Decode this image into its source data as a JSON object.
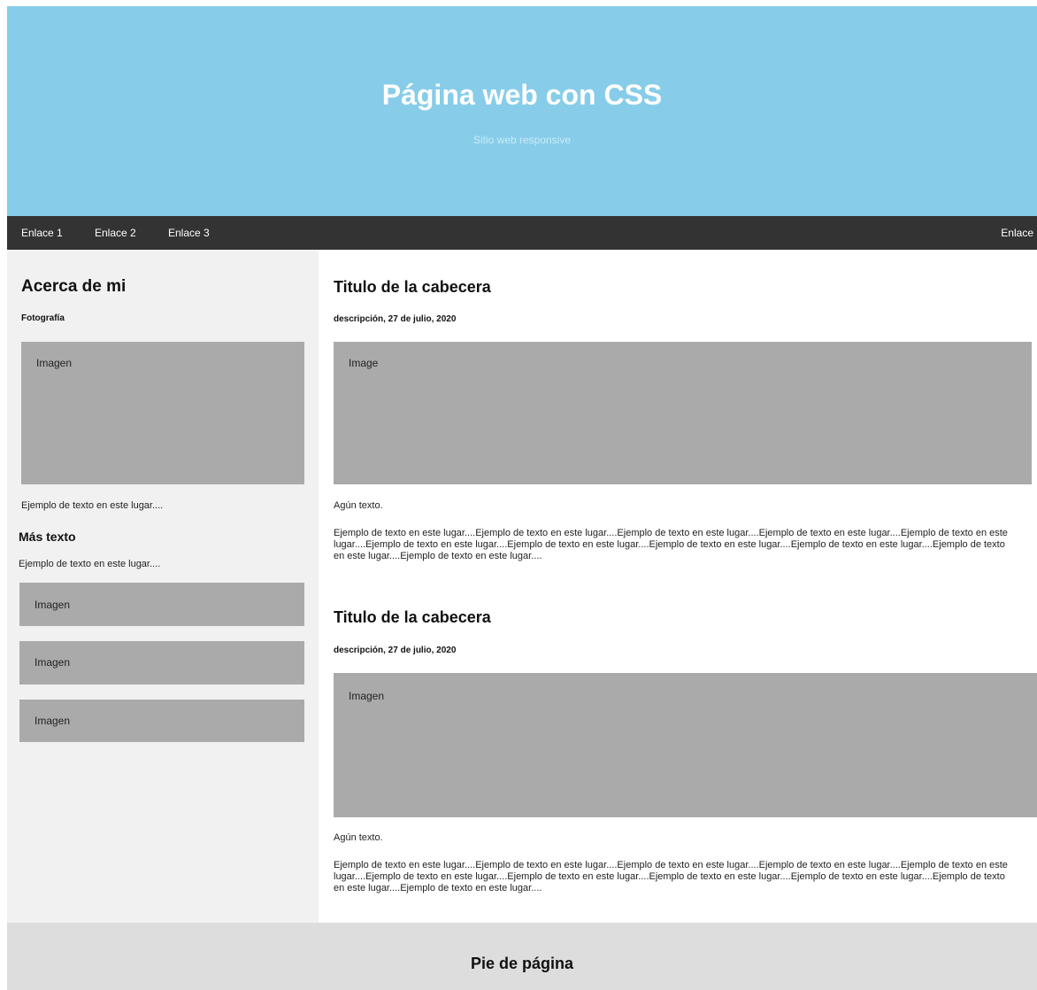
{
  "header": {
    "title": "Página web con CSS",
    "subtitle": "Sitio web responsive"
  },
  "nav": {
    "links": [
      "Enlace 1",
      "Enlace 2",
      "Enlace 3"
    ],
    "right_link": "Enlace"
  },
  "sidebar": {
    "title": "Acerca de mi",
    "photo_label": "Fotografía",
    "photo_placeholder": "Imagen",
    "text1": "Ejemplo de texto en este lugar....",
    "more_title": "Más texto",
    "text2": "Ejemplo de texto en este lugar....",
    "images": [
      "Imagen",
      "Imagen",
      "Imagen"
    ]
  },
  "posts": [
    {
      "title": "Titulo de la cabecera",
      "meta": "descripción, 27 de julio, 2020",
      "image_label": "Image",
      "short_text": "Agún texto.",
      "body": "Ejemplo de texto en este lugar....Ejemplo de texto en este lugar....Ejemplo de texto en este lugar....Ejemplo de texto en este lugar....Ejemplo de texto en este lugar....Ejemplo de texto en este lugar....Ejemplo de texto en este lugar....Ejemplo de texto en este lugar....Ejemplo de texto en este lugar....Ejemplo de texto en este lugar....Ejemplo de texto en este lugar...."
    },
    {
      "title": "Titulo de la cabecera",
      "meta": "descripción, 27 de julio, 2020",
      "image_label": "Imagen",
      "short_text": "Agún texto.",
      "body": "Ejemplo de texto en este lugar....Ejemplo de texto en este lugar....Ejemplo de texto en este lugar....Ejemplo de texto en este lugar....Ejemplo de texto en este lugar....Ejemplo de texto en este lugar....Ejemplo de texto en este lugar....Ejemplo de texto en este lugar....Ejemplo de texto en este lugar....Ejemplo de texto en este lugar....Ejemplo de texto en este lugar...."
    }
  ],
  "footer": {
    "title": "Pie de página"
  }
}
